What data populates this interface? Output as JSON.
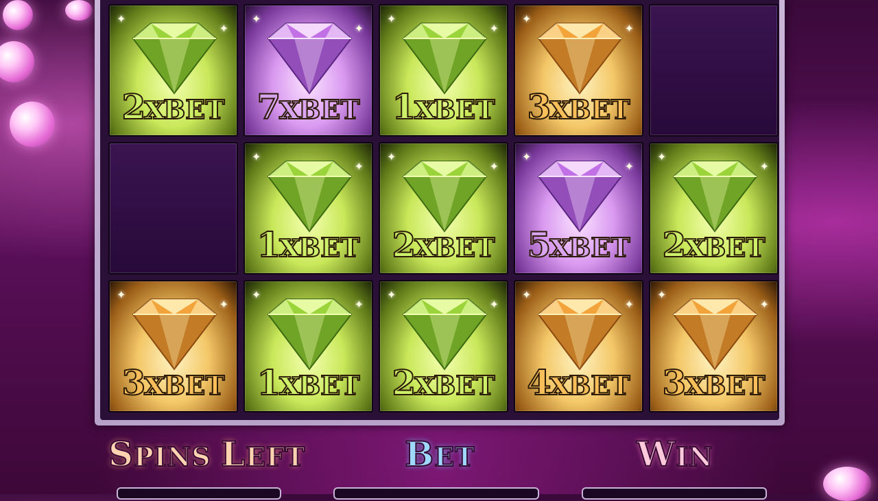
{
  "reels": [
    [
      {
        "color": "green",
        "mult": "2x",
        "bet": "BET"
      },
      {
        "color": "empty"
      },
      {
        "color": "orange",
        "mult": "3x",
        "bet": "BET"
      }
    ],
    [
      {
        "color": "purple",
        "mult": "7x",
        "bet": "BET"
      },
      {
        "color": "green",
        "mult": "1x",
        "bet": "BET"
      },
      {
        "color": "green",
        "mult": "1x",
        "bet": "BET"
      }
    ],
    [
      {
        "color": "green",
        "mult": "1x",
        "bet": "BET"
      },
      {
        "color": "green",
        "mult": "2x",
        "bet": "BET"
      },
      {
        "color": "green",
        "mult": "2x",
        "bet": "BET"
      }
    ],
    [
      {
        "color": "orange",
        "mult": "3x",
        "bet": "BET"
      },
      {
        "color": "purple",
        "mult": "5x",
        "bet": "BET"
      },
      {
        "color": "orange",
        "mult": "4x",
        "bet": "BET"
      }
    ],
    [
      {
        "color": "empty"
      },
      {
        "color": "green",
        "mult": "2x",
        "bet": "BET"
      },
      {
        "color": "orange",
        "mult": "3x",
        "bet": "BET"
      }
    ]
  ],
  "labels": {
    "spins_first": "S",
    "spins_rest": "PINS ",
    "spins_first2": "L",
    "spins_rest2": "EFT",
    "bet_first": "B",
    "bet_rest": "ET",
    "win_first": "W",
    "win_rest": "IN"
  },
  "colors": {
    "green": "#cdf06a",
    "purple": "#d8a4ef",
    "orange": "#f7be5a"
  }
}
